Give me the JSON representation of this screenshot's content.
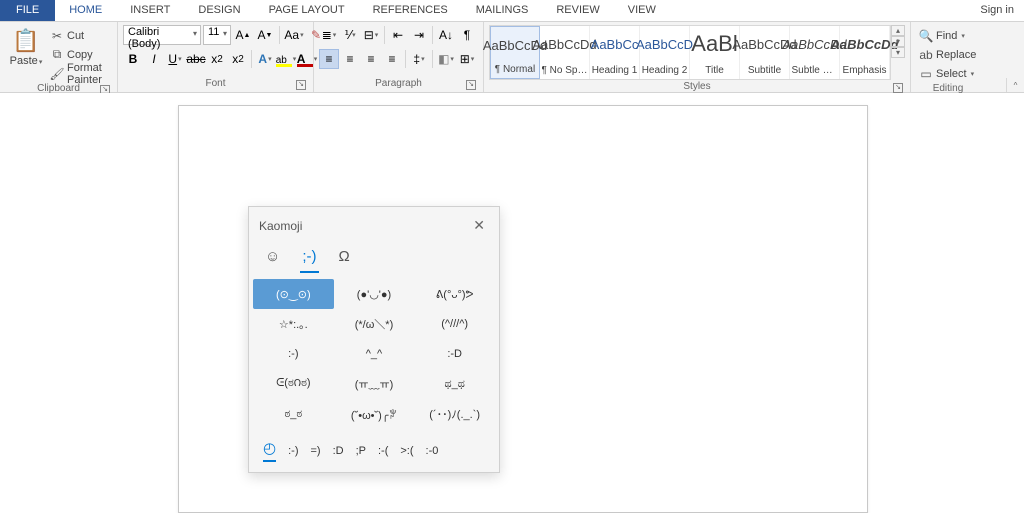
{
  "tabs": {
    "file": "FILE",
    "home": "HOME",
    "insert": "INSERT",
    "design": "DESIGN",
    "page_layout": "PAGE LAYOUT",
    "references": "REFERENCES",
    "mailings": "MAILINGS",
    "review": "REVIEW",
    "view": "VIEW"
  },
  "sign_in": "Sign in",
  "clipboard": {
    "label": "Clipboard",
    "paste": "Paste",
    "cut": "Cut",
    "copy": "Copy",
    "format_painter": "Format Painter"
  },
  "font": {
    "label": "Font",
    "family": "Calibri (Body)",
    "size": "11"
  },
  "paragraph": {
    "label": "Paragraph"
  },
  "styles": {
    "label": "Styles",
    "items": [
      {
        "preview": "AaBbCcDd",
        "name": "¶ Normal",
        "cls": ""
      },
      {
        "preview": "AaBbCcDd",
        "name": "¶ No Spac...",
        "cls": ""
      },
      {
        "preview": "AaBbCc",
        "name": "Heading 1",
        "cls": "blue"
      },
      {
        "preview": "AaBbCcD",
        "name": "Heading 2",
        "cls": "blue"
      },
      {
        "preview": "AaBl",
        "name": "Title",
        "cls": "big"
      },
      {
        "preview": "AaBbCcDd",
        "name": "Subtitle",
        "cls": ""
      },
      {
        "preview": "AaBbCcDd",
        "name": "Subtle Em...",
        "cls": "ital"
      },
      {
        "preview": "AaBbCcDd",
        "name": "Emphasis",
        "cls": "bital"
      }
    ]
  },
  "editing": {
    "label": "Editing",
    "find": "Find",
    "replace": "Replace",
    "select": "Select"
  },
  "kaomoji": {
    "title": "Kaomoji",
    "grid": [
      "(⊙‿⊙)",
      "(●'◡'●)",
      "ᕕ(°ᴗ°)ᕗ",
      "☆*:.｡.",
      "(*/ω＼*)",
      "(^///^)",
      ":-)",
      "^_^",
      ":-D",
      "ᕮ(ಠ౧ಠ)",
      "(ㅠ﹏ㅠ)",
      "ಥ_ಥ",
      "ಠ_ಠ",
      "(˘•ω•˘)╭ꐕ",
      "(´･･)ﾉ(._.`)"
    ],
    "recents": [
      ":-)",
      "=)",
      ":D",
      ";P",
      ":-(",
      ">:(",
      ":-0"
    ]
  }
}
